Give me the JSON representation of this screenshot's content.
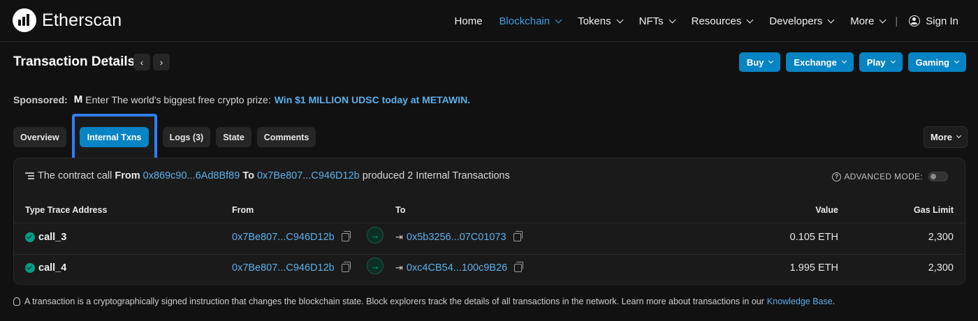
{
  "brand": {
    "name": "Etherscan"
  },
  "nav": {
    "items": [
      {
        "label": "Home",
        "dropdown": false,
        "active": false
      },
      {
        "label": "Blockchain",
        "dropdown": true,
        "active": true
      },
      {
        "label": "Tokens",
        "dropdown": true,
        "active": false
      },
      {
        "label": "NFTs",
        "dropdown": true,
        "active": false
      },
      {
        "label": "Resources",
        "dropdown": true,
        "active": false
      },
      {
        "label": "Developers",
        "dropdown": true,
        "active": false
      },
      {
        "label": "More",
        "dropdown": true,
        "active": false
      }
    ],
    "separator": "|",
    "sign_in": "Sign In"
  },
  "page": {
    "title": "Transaction Details",
    "prev_arrow": "‹",
    "next_arrow": "›"
  },
  "top_buttons": {
    "buy": "Buy",
    "exchange": "Exchange",
    "play": "Play",
    "gaming": "Gaming"
  },
  "sponsored": {
    "label": "Sponsored:",
    "logo_text": "M",
    "text": "Enter The world's biggest free crypto prize:",
    "link": "Win $1 MILLION UDSC today at METAWIN."
  },
  "tabs": {
    "overview": "Overview",
    "internal_txns": "Internal Txns",
    "logs": "Logs (3)",
    "state": "State",
    "comments": "Comments",
    "more": "More"
  },
  "summary": {
    "prefix": "The contract call",
    "from_label": "From",
    "from_address": "0x869c90...6Ad8Bf89",
    "to_label": "To",
    "to_address": "0x7Be807...C946D12b",
    "suffix": "produced 2 Internal Transactions",
    "advanced_mode": "ADVANCED MODE:"
  },
  "table": {
    "headers": {
      "type": "Type Trace Address",
      "from": "From",
      "to": "To",
      "value": "Value",
      "gas": "Gas Limit"
    },
    "rows": [
      {
        "type": "call_3",
        "from": "0x7Be807...C946D12b",
        "to": "0x5b3256...07C01073",
        "value": "0.105 ETH",
        "gas": "2,300"
      },
      {
        "type": "call_4",
        "from": "0x7Be807...C946D12b",
        "to": "0xc4CB54...100c9B26",
        "value": "1.995 ETH",
        "gas": "2,300"
      }
    ]
  },
  "footer": {
    "text": "A transaction is a cryptographically signed instruction that changes the blockchain state. Block explorers track the details of all transactions in the network. Learn more about transactions in our",
    "link": "Knowledge Base",
    "end": "."
  },
  "colors": {
    "background": "#111111",
    "card": "#1a1a1a",
    "accent": "#0784c3",
    "link": "#5cb0ea",
    "success": "#00a186",
    "highlight_border": "#2f7df6"
  }
}
